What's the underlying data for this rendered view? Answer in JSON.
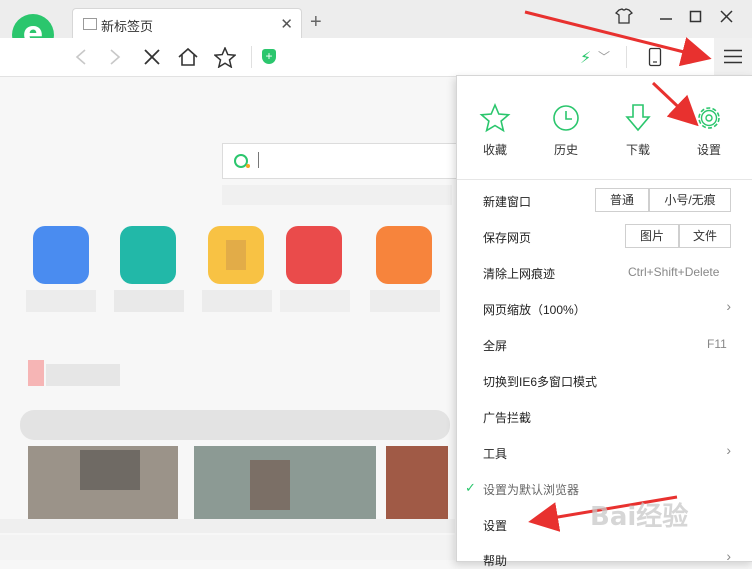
{
  "tab": {
    "title": "新标签页",
    "close_icon": "close-icon",
    "new_tab_icon": "plus-icon"
  },
  "window": {
    "skin_icon": "tshirt-icon",
    "minimize_icon": "minimize-icon",
    "maximize_icon": "maximize-icon",
    "close_icon": "close-icon"
  },
  "toolbar": {
    "back_icon": "back-icon",
    "forward_icon": "forward-icon",
    "stop_icon": "stop-icon",
    "home_icon": "home-icon",
    "star_icon": "star-icon",
    "shield_icon": "shield-icon",
    "speed_icon": "lightning-icon",
    "device_icon": "phone-icon",
    "menu_icon": "hamburger-icon"
  },
  "menu": {
    "quick_actions": [
      {
        "label": "收藏",
        "icon": "star-icon"
      },
      {
        "label": "历史",
        "icon": "clock-icon"
      },
      {
        "label": "下载",
        "icon": "download-icon"
      },
      {
        "label": "设置",
        "icon": "gear-icon"
      }
    ],
    "items": {
      "new_window": {
        "label": "新建窗口",
        "opt1": "普通",
        "opt2": "小号/无痕"
      },
      "save_page": {
        "label": "保存网页",
        "opt1": "图片",
        "opt2": "文件"
      },
      "clear_traces": {
        "label": "清除上网痕迹",
        "shortcut": "Ctrl+Shift+Delete"
      },
      "zoom": {
        "label": "网页缩放（100%）"
      },
      "fullscreen": {
        "label": "全屏",
        "shortcut": "F11"
      },
      "ie6_mode": {
        "label": "切换到IE6多窗口模式"
      },
      "adblock": {
        "label": "广告拦截"
      },
      "tools": {
        "label": "工具"
      },
      "default_browser": {
        "label": "设置为默认浏览器"
      },
      "settings": {
        "label": "设置"
      },
      "help": {
        "label": "帮助"
      }
    }
  },
  "colors": {
    "accent": "#2bc66d",
    "arrow": "#e8312f"
  },
  "watermark": "Bai经验"
}
